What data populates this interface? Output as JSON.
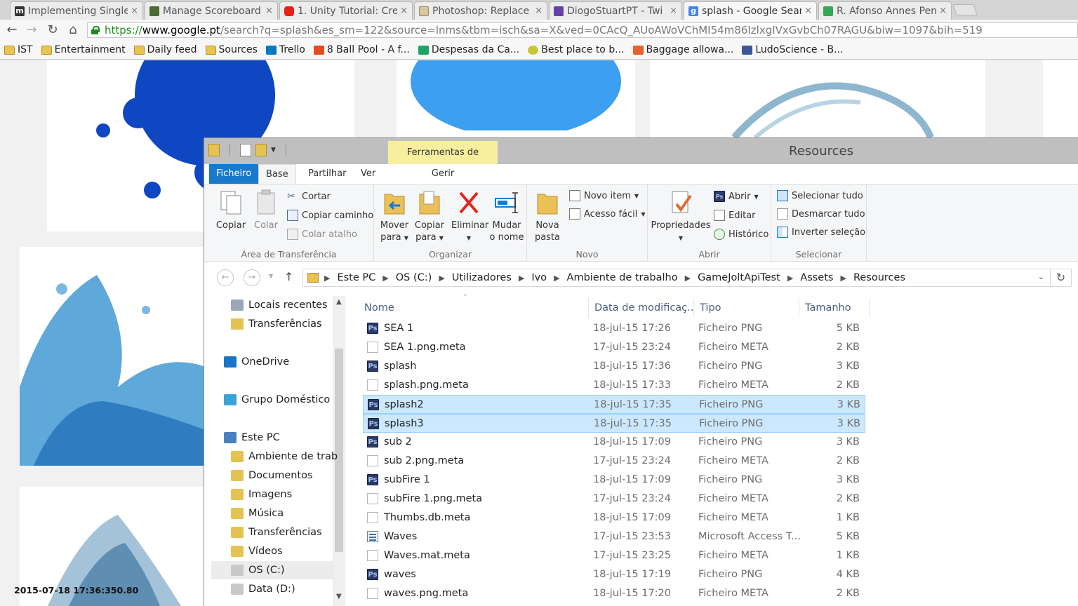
{
  "browser": {
    "tabs": [
      {
        "title": "Implementing Single",
        "favicon": "m-icon",
        "color": "#333333"
      },
      {
        "title": "Manage Scoreboard",
        "favicon": "gamejolt-icon",
        "color": "#4b6b32"
      },
      {
        "title": "1. Unity Tutorial: Cre",
        "favicon": "youtube-icon",
        "color": "#e62117"
      },
      {
        "title": "Photoshop: Replace",
        "favicon": "page-icon",
        "color": "#b89a6a"
      },
      {
        "title": "DiogoStuartPT - Twi",
        "favicon": "twitch-icon",
        "color": "#6441a5"
      },
      {
        "title": "splash - Google Sear",
        "favicon": "google-icon",
        "color": "#4285f4"
      },
      {
        "title": "R. Afonso Annes Pen",
        "favicon": "maps-icon",
        "color": "#34a853"
      }
    ],
    "url": {
      "scheme": "https://",
      "host": "www.google.pt",
      "path": "/search?q=splash&es_sm=122&source=lnms&tbm=isch&sa=X&ved=0CAcQ_AUoAWoVChMI54m86IzlxgIVxGvbCh07RAGU&biw=1097&bih=519"
    },
    "bookmarks": [
      {
        "label": "IST",
        "icon": "folder-icon"
      },
      {
        "label": "Entertainment",
        "icon": "folder-icon"
      },
      {
        "label": "Daily feed",
        "icon": "folder-icon"
      },
      {
        "label": "Sources",
        "icon": "folder-icon"
      },
      {
        "label": "Trello",
        "icon": "trello-icon"
      },
      {
        "label": "8 Ball Pool - A f...",
        "icon": "play-icon"
      },
      {
        "label": "Despesas da Ca...",
        "icon": "sheets-icon"
      },
      {
        "label": "Best place to b...",
        "icon": "smiley-icon"
      },
      {
        "label": "Baggage allowa...",
        "icon": "bookmark-c-icon"
      },
      {
        "label": "LudoScience - B...",
        "icon": "facebook-icon"
      }
    ]
  },
  "explorer": {
    "window_title": "Resources",
    "context_tab": "Ferramentas de Imagem",
    "ribbon_tabs": [
      "Ficheiro",
      "Base",
      "Partilhar",
      "Ver",
      "Gerir"
    ],
    "groups": {
      "clipboard": {
        "label": "Área de Transferência",
        "copy": "Copiar",
        "paste": "Colar",
        "cut": "Cortar",
        "copy_path": "Copiar caminho",
        "paste_shortcut": "Colar atalho"
      },
      "organize": {
        "label": "Organizar",
        "move_to": [
          "Mover",
          "para"
        ],
        "copy_to": [
          "Copiar",
          "para"
        ],
        "delete": "Eliminar",
        "rename": [
          "Mudar",
          "o nome"
        ]
      },
      "new": {
        "label": "Novo",
        "new_folder": [
          "Nova",
          "pasta"
        ],
        "new_item": "Novo item",
        "easy_access": "Acesso fácil"
      },
      "open": {
        "label": "Abrir",
        "properties": "Propriedades",
        "open": "Abrir",
        "edit": "Editar",
        "history": "Histórico"
      },
      "select": {
        "label": "Selecionar",
        "select_all": "Selecionar tudo",
        "select_none": "Desmarcar tudo",
        "invert": "Inverter seleção"
      }
    },
    "breadcrumb": [
      "Este PC",
      "OS (C:)",
      "Utilizadores",
      "Ivo",
      "Ambiente de trabalho",
      "GameJoltApiTest",
      "Assets",
      "Resources"
    ],
    "nav": [
      {
        "label": "Locais recentes",
        "icon": "recent-places-icon",
        "indent": 1
      },
      {
        "label": "Transferências",
        "icon": "downloads-icon",
        "indent": 1
      },
      {
        "label": "OneDrive",
        "icon": "onedrive-icon",
        "indent": 0
      },
      {
        "label": "Grupo Doméstico",
        "icon": "homegroup-icon",
        "indent": 0
      },
      {
        "label": "Este PC",
        "icon": "computer-icon",
        "indent": 0
      },
      {
        "label": "Ambiente de trab",
        "icon": "desktop-folder-icon",
        "indent": 1
      },
      {
        "label": "Documentos",
        "icon": "documents-folder-icon",
        "indent": 1
      },
      {
        "label": "Imagens",
        "icon": "pictures-folder-icon",
        "indent": 1
      },
      {
        "label": "Música",
        "icon": "music-folder-icon",
        "indent": 1
      },
      {
        "label": "Transferências",
        "icon": "downloads-folder-icon",
        "indent": 1
      },
      {
        "label": "Vídeos",
        "icon": "videos-folder-icon",
        "indent": 1
      },
      {
        "label": "OS (C:)",
        "icon": "drive-c-icon",
        "indent": 1,
        "selected": true
      },
      {
        "label": "Data (D:)",
        "icon": "drive-d-icon",
        "indent": 1
      }
    ],
    "columns": [
      "Nome",
      "Data de modificaç...",
      "Tipo",
      "Tamanho"
    ],
    "files": [
      {
        "name": "SEA 1",
        "date": "18-jul-15 17:26",
        "type": "Ficheiro PNG",
        "size": "5 KB",
        "icon": "ps",
        "selected": false
      },
      {
        "name": "SEA 1.png.meta",
        "date": "17-jul-15 23:24",
        "type": "Ficheiro META",
        "size": "2 KB",
        "icon": "blank",
        "selected": false
      },
      {
        "name": "splash",
        "date": "18-jul-15 17:36",
        "type": "Ficheiro PNG",
        "size": "3 KB",
        "icon": "ps",
        "selected": false
      },
      {
        "name": "splash.png.meta",
        "date": "18-jul-15 17:33",
        "type": "Ficheiro META",
        "size": "2 KB",
        "icon": "blank",
        "selected": false
      },
      {
        "name": "splash2",
        "date": "18-jul-15 17:35",
        "type": "Ficheiro PNG",
        "size": "3 KB",
        "icon": "ps",
        "selected": true
      },
      {
        "name": "splash3",
        "date": "18-jul-15 17:35",
        "type": "Ficheiro PNG",
        "size": "3 KB",
        "icon": "ps",
        "selected": true
      },
      {
        "name": "sub 2",
        "date": "18-jul-15 17:09",
        "type": "Ficheiro PNG",
        "size": "3 KB",
        "icon": "ps",
        "selected": false
      },
      {
        "name": "sub 2.png.meta",
        "date": "17-jul-15 23:24",
        "type": "Ficheiro META",
        "size": "2 KB",
        "icon": "blank",
        "selected": false
      },
      {
        "name": "subFire 1",
        "date": "18-jul-15 17:09",
        "type": "Ficheiro PNG",
        "size": "3 KB",
        "icon": "ps",
        "selected": false
      },
      {
        "name": "subFire 1.png.meta",
        "date": "17-jul-15 23:24",
        "type": "Ficheiro META",
        "size": "2 KB",
        "icon": "blank",
        "selected": false
      },
      {
        "name": "Thumbs.db.meta",
        "date": "18-jul-15 17:09",
        "type": "Ficheiro META",
        "size": "1 KB",
        "icon": "blank",
        "selected": false
      },
      {
        "name": "Waves",
        "date": "17-jul-15 23:53",
        "type": "Microsoft Access T...",
        "size": "5 KB",
        "icon": "access",
        "selected": false
      },
      {
        "name": "Waves.mat.meta",
        "date": "17-jul-15 23:25",
        "type": "Ficheiro META",
        "size": "1 KB",
        "icon": "blank",
        "selected": false
      },
      {
        "name": "waves",
        "date": "18-jul-15 17:19",
        "type": "Ficheiro PNG",
        "size": "4 KB",
        "icon": "ps",
        "selected": false
      },
      {
        "name": "waves.png.meta",
        "date": "18-jul-15 17:20",
        "type": "Ficheiro META",
        "size": "2 KB",
        "icon": "blank",
        "selected": false
      }
    ]
  },
  "overlay_timestamp": "2015-07-18 17:36:350.80"
}
